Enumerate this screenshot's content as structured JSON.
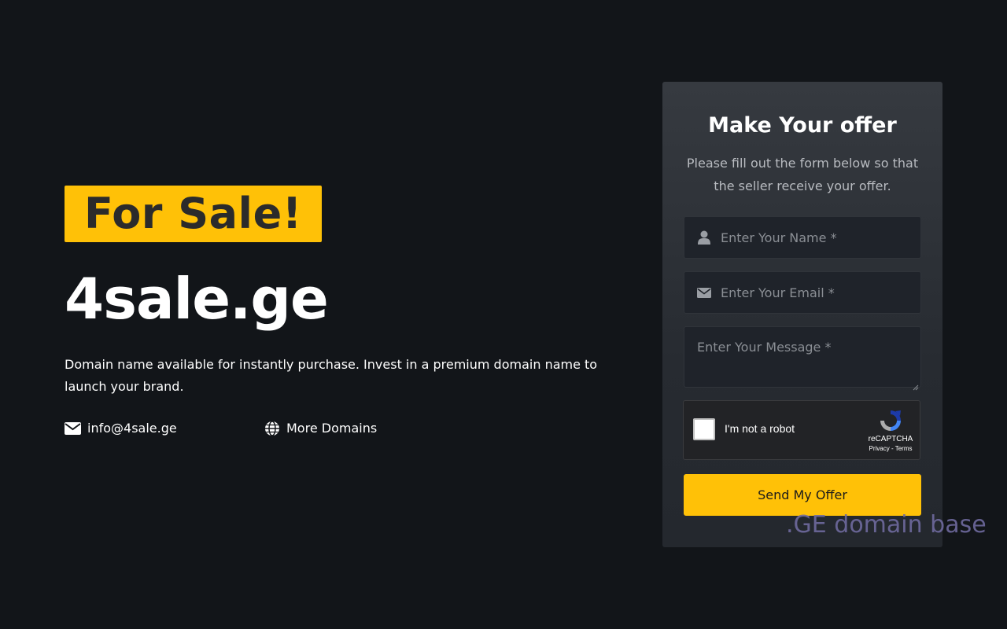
{
  "hero": {
    "badge": "For Sale!",
    "domain": "4sale.ge",
    "description": "Domain name available for instantly purchase. Invest in a premium domain name to launch your brand."
  },
  "contact": {
    "email": "info@4sale.ge",
    "email_icon": "envelope-icon",
    "more_domains": "More Domains",
    "more_domains_icon": "globe-icon"
  },
  "offer_form": {
    "title": "Make Your offer",
    "subtitle": "Please fill out the form below so that the seller receive your offer.",
    "name_placeholder": "Enter Your Name *",
    "name_icon": "user-icon",
    "email_placeholder": "Enter Your Email *",
    "email_icon": "envelope-icon",
    "message_placeholder": "Enter Your Message *",
    "captcha_label": "I'm not a robot",
    "captcha_brand": "reCAPTCHA",
    "captcha_links": "Privacy - Terms",
    "submit_label": "Send My Offer"
  },
  "watermark": ".GE domain base",
  "colors": {
    "background": "#121519",
    "accent": "#ffc107",
    "card": "#30343a",
    "field": "#1f232a"
  }
}
